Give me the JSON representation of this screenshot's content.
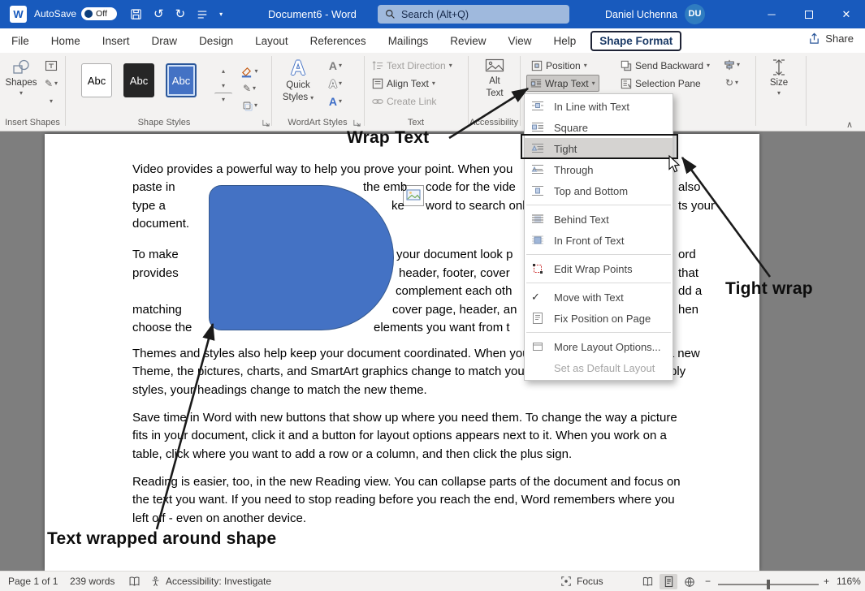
{
  "titlebar": {
    "app_letter": "W",
    "autosave_label": "AutoSave",
    "autosave_state": "Off",
    "doc_title": "Document6 - Word",
    "search_placeholder": "Search (Alt+Q)",
    "user_name": "Daniel Uchenna",
    "user_initials": "DU"
  },
  "icons": {
    "chevron_down": "▾",
    "chevron_up": "▴",
    "collapse_ribbon": "∧",
    "undo": "↺",
    "redo": "↻",
    "check": "✓",
    "minimize": "─",
    "close": "✕",
    "zoom_out": "−",
    "zoom_in": "+",
    "pencil": "✎"
  },
  "menubar": {
    "tabs": [
      "File",
      "Home",
      "Insert",
      "Draw",
      "Design",
      "Layout",
      "References",
      "Mailings",
      "Review",
      "View",
      "Help",
      "Shape Format"
    ],
    "share": "Share"
  },
  "ribbon": {
    "insert_shapes": {
      "label": "Insert Shapes",
      "shapes": "Shapes"
    },
    "shape_styles": {
      "label": "Shape Styles",
      "preset": "Abc"
    },
    "wordart": {
      "label": "WordArt Styles",
      "quick": "Quick",
      "styles": "Styles"
    },
    "text": {
      "label": "Text",
      "direction": "Text Direction",
      "align": "Align Text",
      "link": "Create Link"
    },
    "accessibility": {
      "label": "Accessibility",
      "alt1": "Alt",
      "alt2": "Text"
    },
    "arrange": {
      "position": "Position",
      "wrap": "Wrap Text",
      "send_backward": "Send Backward",
      "selection_pane": "Selection Pane"
    },
    "size": {
      "label": "Size"
    }
  },
  "wrap_menu": {
    "items": [
      {
        "label": "In Line with Text"
      },
      {
        "label": "Square"
      },
      {
        "label": "Tight"
      },
      {
        "label": "Through"
      },
      {
        "label": "Top and Bottom"
      },
      {
        "label": "Behind Text"
      },
      {
        "label": "In Front of Text"
      },
      {
        "label": "Edit Wrap Points"
      },
      {
        "label": "Move with Text"
      },
      {
        "label": "Fix Position on Page"
      },
      {
        "label": "More Layout Options..."
      },
      {
        "label": "Set as Default Layout"
      }
    ]
  },
  "doc": {
    "lines": [
      "Video provides a powerful way to help you prove your point. When you",
      "paste in",
      "the emb",
      "code for the vide",
      "also",
      "type a",
      "ke",
      "word to search onlin",
      "ts your",
      "document.",
      "To make",
      "your document look p",
      "ord",
      "provides",
      "header, footer, cover",
      "that",
      "complement each oth",
      "dd a",
      "matching",
      "cover page, header, an",
      "hen",
      "choose the",
      "elements you want from t",
      "Themes and styles also help keep your document coordinated. When you click Design and choose a new",
      "Theme, the pictures, charts, and SmartArt graphics change to match your new theme. When you apply",
      "styles, your headings change to match the new theme.",
      "Save time in Word with new buttons that show up where you need them. To change the way a picture",
      "fits in your document, click it and a button for layout options appears next to it. When you work on a",
      "table, click where you want to add a row or a column, and then click the plus sign.",
      "Reading is easier, too, in the new Reading view. You can collapse parts of the document and focus on",
      "the text you want. If you need to stop reading before you reach the end, Word remembers where you",
      "left off - even on another device."
    ]
  },
  "annotations": {
    "wrap_text": "Wrap Text",
    "tight_wrap": "Tight wrap",
    "wrapped_shape": "Text wrapped around shape"
  },
  "statusbar": {
    "page": "Page 1 of 1",
    "words": "239 words",
    "accessibility": "Accessibility: Investigate",
    "focus": "Focus",
    "zoom": "116%"
  },
  "colors": {
    "titlebar": "#185abd",
    "accent": "#2b579a",
    "shape_fill": "#4472c4"
  }
}
